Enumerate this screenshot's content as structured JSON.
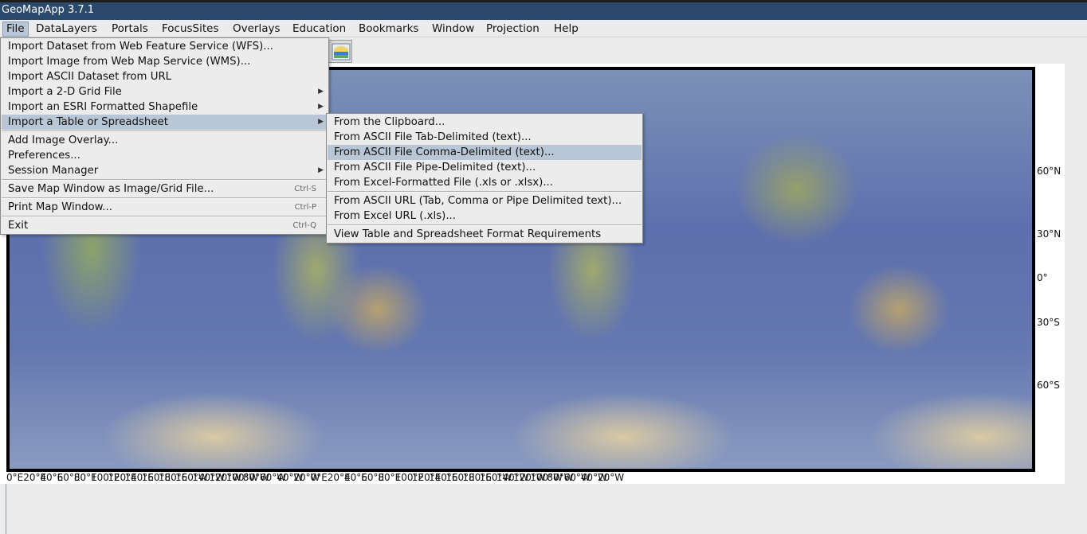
{
  "app": {
    "title": "GeoMapApp 3.7.1"
  },
  "menubar": {
    "items": [
      "File",
      "DataLayers",
      "Portals",
      "FocusSites",
      "Overlays",
      "Education",
      "Bookmarks",
      "Window",
      "Projection",
      "Help"
    ]
  },
  "file_menu": {
    "items": [
      {
        "label": "Import Dataset from Web Feature Service (WFS)..."
      },
      {
        "label": "Import Image from Web Map Service (WMS)..."
      },
      {
        "label": "Import ASCII Dataset from URL"
      },
      {
        "label": "Import a 2-D Grid File"
      },
      {
        "label": "Import an ESRI Formatted Shapefile"
      },
      {
        "label": "Import a Table or Spreadsheet"
      },
      {
        "label": "Add Image Overlay..."
      },
      {
        "label": "Preferences..."
      },
      {
        "label": "Session Manager"
      },
      {
        "label": "Save Map Window as Image/Grid File...",
        "accel": "Ctrl-S"
      },
      {
        "label": "Print Map Window...",
        "accel": "Ctrl-P"
      },
      {
        "label": "Exit",
        "accel": "Ctrl-Q"
      }
    ]
  },
  "submenu": {
    "items": [
      {
        "label": "From the Clipboard..."
      },
      {
        "label": "From ASCII File Tab-Delimited (text)..."
      },
      {
        "label": "From ASCII File Comma-Delimited (text)..."
      },
      {
        "label": "From ASCII File Pipe-Delimited (text)..."
      },
      {
        "label": "From Excel-Formatted File (.xls or .xlsx)..."
      },
      {
        "label": "From ASCII URL (Tab, Comma or Pipe Delimited text)..."
      },
      {
        "label": "From Excel URL (.xls)..."
      },
      {
        "label": "View Table and Spreadsheet Format Requirements"
      }
    ]
  },
  "map": {
    "lat_labels": [
      "60°N",
      "30°N",
      "0°",
      "30°S",
      "60°S"
    ],
    "lon_labels": [
      "0°E",
      "20°E",
      "40°E",
      "60°E",
      "80°E",
      "100°E",
      "120°E",
      "140°E",
      "160°E",
      "180°E",
      "160°W",
      "140°W",
      "120°W",
      "100°W",
      "80°W",
      "60°W",
      "40°W",
      "20°W",
      "0°E",
      "20°E",
      "40°E",
      "60°E",
      "80°E",
      "100°E",
      "120°E",
      "140°E",
      "160°E",
      "180°E",
      "160°W",
      "140°W",
      "120°W",
      "100°W",
      "80°W",
      "60°W",
      "40°W",
      "20°W"
    ]
  },
  "colors": {
    "title_bar": "#2b4a6b",
    "highlight": "#b8c6d6",
    "menu_bg": "#ececec"
  }
}
